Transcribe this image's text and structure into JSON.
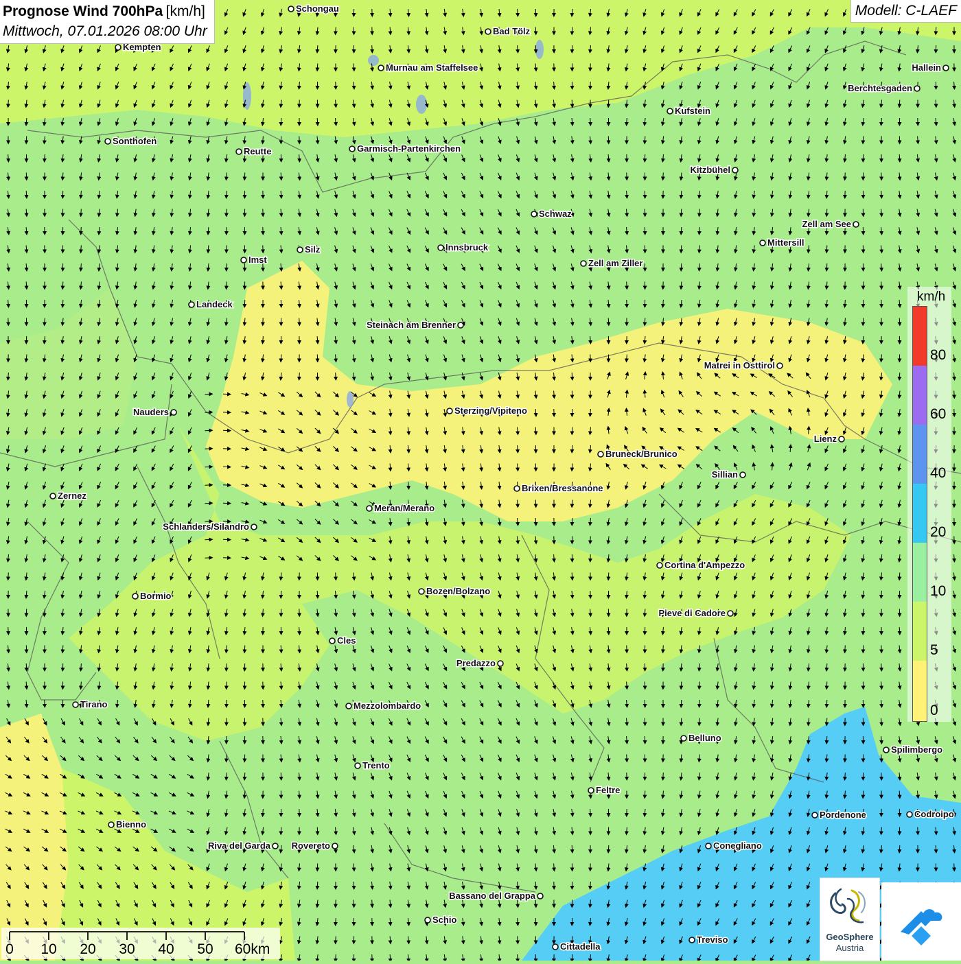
{
  "title": {
    "main": "Prognose Wind 700hPa",
    "unit": "[km/h]",
    "datetime": "Mittwoch, 07.01.2026 08:00 Uhr"
  },
  "model_label": "Modell: C-LAEF",
  "legend": {
    "unit": "km/h",
    "labels": [
      "80",
      "60",
      "40",
      "20",
      "10",
      "5",
      "0"
    ],
    "colors": [
      "#f23a2a",
      "#9b6cf0",
      "#5c94f0",
      "#34c8f2",
      "#9af0a0",
      "#ccf56a",
      "#fff276"
    ]
  },
  "scale_bar": {
    "labels": [
      "0",
      "10",
      "20",
      "30",
      "40",
      "50",
      "60km"
    ]
  },
  "logo": {
    "name_line1": "GeoSphere",
    "name_line2": "Austria"
  },
  "cities": [
    {
      "name": "Schongau",
      "side": "right"
    },
    {
      "name": "Bad Tölz",
      "side": "right"
    },
    {
      "name": "Kempten",
      "side": "right"
    },
    {
      "name": "Murnau am Staffelsee",
      "side": "right"
    },
    {
      "name": "Hallein",
      "side": "left"
    },
    {
      "name": "Berchtesgaden",
      "side": "left"
    },
    {
      "name": "Kufstein",
      "side": "right"
    },
    {
      "name": "Sonthofen",
      "side": "right"
    },
    {
      "name": "Reutte",
      "side": "right"
    },
    {
      "name": "Garmisch-Partenkirchen",
      "side": "right"
    },
    {
      "name": "Kitzbühel",
      "side": "left"
    },
    {
      "name": "Schwaz",
      "side": "right"
    },
    {
      "name": "Zell am See",
      "side": "left"
    },
    {
      "name": "Mittersill",
      "side": "right"
    },
    {
      "name": "Innsbruck",
      "side": "right"
    },
    {
      "name": "Silz",
      "side": "right"
    },
    {
      "name": "Imst",
      "side": "right"
    },
    {
      "name": "Zell am Ziller",
      "side": "right"
    },
    {
      "name": "Landeck",
      "side": "right"
    },
    {
      "name": "Steinach am Brenner",
      "side": "left"
    },
    {
      "name": "Matrei in Osttirol",
      "side": "left"
    },
    {
      "name": "Nauders",
      "side": "left"
    },
    {
      "name": "Sterzing/Vipiteno",
      "side": "right"
    },
    {
      "name": "Lienz",
      "side": "left"
    },
    {
      "name": "Bruneck/Brunico",
      "side": "right"
    },
    {
      "name": "Sillian",
      "side": "left"
    },
    {
      "name": "Brixen/Bressanone",
      "side": "right"
    },
    {
      "name": "Zernez",
      "side": "right"
    },
    {
      "name": "Meran/Merano",
      "side": "right"
    },
    {
      "name": "Schlanders/Silandro",
      "side": "left"
    },
    {
      "name": "Cortina d'Ampezzo",
      "side": "right"
    },
    {
      "name": "Bozen/Bolzano",
      "side": "right"
    },
    {
      "name": "Bormio",
      "side": "right"
    },
    {
      "name": "Pieve di Cadore",
      "side": "left"
    },
    {
      "name": "Cles",
      "side": "right"
    },
    {
      "name": "Predazzo",
      "side": "left"
    },
    {
      "name": "Tirano",
      "side": "right"
    },
    {
      "name": "Mezzolombardo",
      "side": "right"
    },
    {
      "name": "Belluno",
      "side": "right"
    },
    {
      "name": "Spilimbergo",
      "side": "right"
    },
    {
      "name": "Trento",
      "side": "right"
    },
    {
      "name": "Feltre",
      "side": "right"
    },
    {
      "name": "Pordenone",
      "side": "right"
    },
    {
      "name": "Codroipo",
      "side": "right"
    },
    {
      "name": "Bienno",
      "side": "right"
    },
    {
      "name": "Riva del Garda",
      "side": "left"
    },
    {
      "name": "Rovereto",
      "side": "left"
    },
    {
      "name": "Conegliano",
      "side": "right"
    },
    {
      "name": "Bassano del Grappa",
      "side": "left"
    },
    {
      "name": "Schio",
      "side": "right"
    },
    {
      "name": "Treviso",
      "side": "right"
    },
    {
      "name": "Cittadella",
      "side": "right"
    }
  ]
}
